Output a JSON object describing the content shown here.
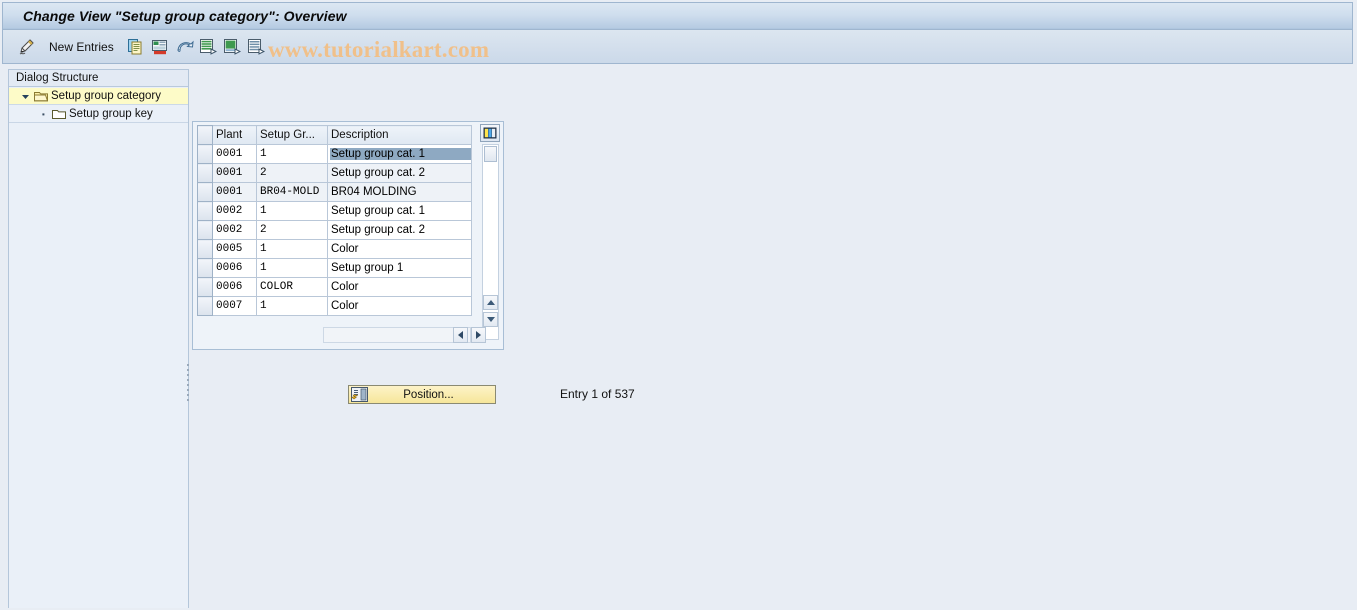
{
  "window": {
    "title": "Change View \"Setup group category\": Overview"
  },
  "toolbar": {
    "pencil_icon": "pencil-display-change-icon",
    "new_entries_label": "New Entries",
    "buttons": [
      {
        "name": "copy-as-icon",
        "tooltip": "Copy As..."
      },
      {
        "name": "delete-icon",
        "tooltip": "Delete"
      },
      {
        "name": "undo-icon",
        "tooltip": "Undo Change"
      },
      {
        "name": "select-all-icon",
        "tooltip": "Select All"
      },
      {
        "name": "deselect-all-icon",
        "tooltip": "Deselect All"
      },
      {
        "name": "select-block-icon",
        "tooltip": "Select Block"
      }
    ],
    "watermark": "www.tutorialkart.com"
  },
  "sidebar": {
    "header": "Dialog Structure",
    "tree": [
      {
        "label": "Setup group category",
        "icon": "open-folder-icon",
        "expanded": true,
        "selected": true
      },
      {
        "label": "Setup group key",
        "icon": "closed-folder-icon",
        "expanded": false,
        "selected": false
      }
    ]
  },
  "table": {
    "columns": [
      "Plant",
      "Setup Gr...",
      "Description"
    ],
    "rows": [
      {
        "plant": "0001",
        "key": "1",
        "description": "Setup group cat. 1",
        "selected": true
      },
      {
        "plant": "0001",
        "key": "2",
        "description": "Setup group cat. 2",
        "selected": false
      },
      {
        "plant": "0001",
        "key": "BR04-MOLD",
        "description": "BR04 MOLDING",
        "selected": false
      },
      {
        "plant": "0002",
        "key": "1",
        "description": "Setup group cat. 1",
        "selected": false
      },
      {
        "plant": "0002",
        "key": "2",
        "description": "Setup group cat. 2",
        "selected": false
      },
      {
        "plant": "0005",
        "key": "1",
        "description": "Color",
        "selected": false
      },
      {
        "plant": "0006",
        "key": "1",
        "description": "Setup group 1",
        "selected": false
      },
      {
        "plant": "0006",
        "key": "COLOR",
        "description": "Color",
        "selected": false
      },
      {
        "plant": "0007",
        "key": "1",
        "description": "Color",
        "selected": false
      }
    ],
    "column_config_icon": "table-settings-icon"
  },
  "footer": {
    "position_button_label": "Position...",
    "position_button_icon": "position-jump-icon",
    "entry_status": "Entry 1 of 537"
  },
  "colors": {
    "titlebar_top": "#dce7f2",
    "titlebar_bottom": "#a9c1dd",
    "tree_selected": "#fdfbc8",
    "cell_selected": "#8ea9c2",
    "button_yellow": "#f6e69a",
    "watermark": "#f0c08a",
    "body_bg": "#e8edf4"
  }
}
